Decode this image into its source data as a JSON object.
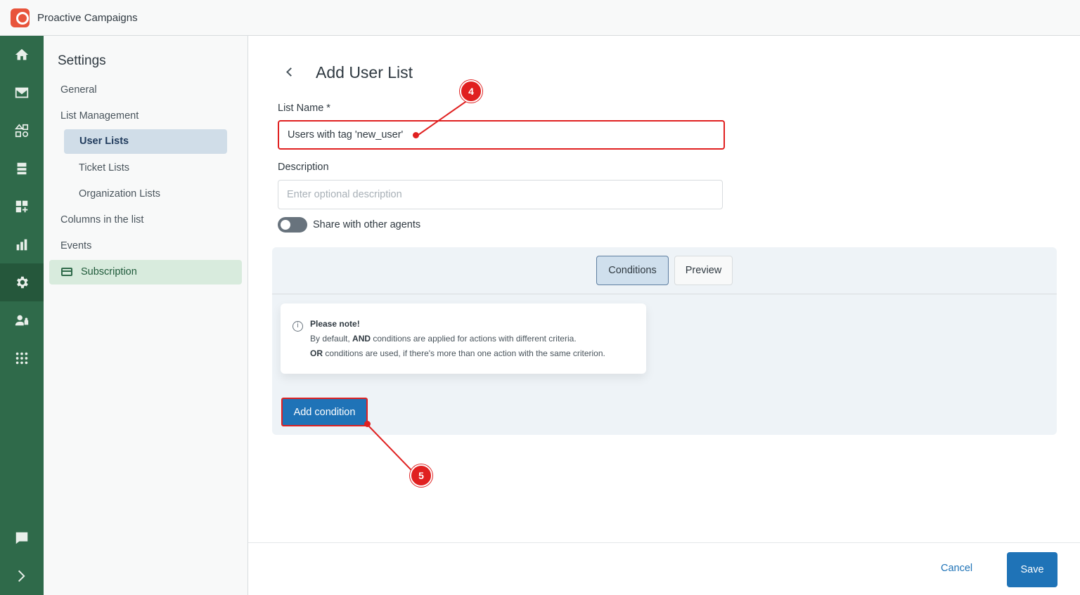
{
  "app": {
    "title": "Proactive Campaigns"
  },
  "rail": {
    "icons": [
      "home-icon",
      "mail-icon",
      "shapes-icon",
      "ticket-list-icon",
      "widgets-icon",
      "bar-chart-icon",
      "gear-icon",
      "users-lock-icon",
      "apps-grid-icon",
      "chat-icon",
      "chevron-right-icon"
    ],
    "active": "gear-icon"
  },
  "sidebar": {
    "title": "Settings",
    "items": {
      "general": "General",
      "list_management": "List Management",
      "user_lists": "User Lists",
      "ticket_lists": "Ticket Lists",
      "organization_lists": "Organization Lists",
      "columns": "Columns in the list",
      "events": "Events",
      "subscription": "Subscription"
    }
  },
  "main": {
    "title": "Add User List",
    "list_name_label": "List Name *",
    "list_name_value": "Users with tag 'new_user'",
    "description_label": "Description",
    "description_placeholder": "Enter optional description",
    "share_label": "Share with other agents",
    "tabs": {
      "conditions": "Conditions",
      "preview": "Preview"
    },
    "note": {
      "icon": "i",
      "title": "Please note!",
      "line1_prefix": "By default, ",
      "line1_bold": "AND",
      "line1_suffix": " conditions are applied for actions with different criteria.",
      "line2_bold": "OR",
      "line2_suffix": " conditions are used, if there's more than one action with the same criterion."
    },
    "add_condition": "Add condition"
  },
  "footer": {
    "cancel": "Cancel",
    "save": "Save"
  },
  "annotations": {
    "step4": "4",
    "step5": "5"
  },
  "colors": {
    "accent": "#1f73b7",
    "rail": "#2f6a4a",
    "annotation": "#e02020"
  }
}
